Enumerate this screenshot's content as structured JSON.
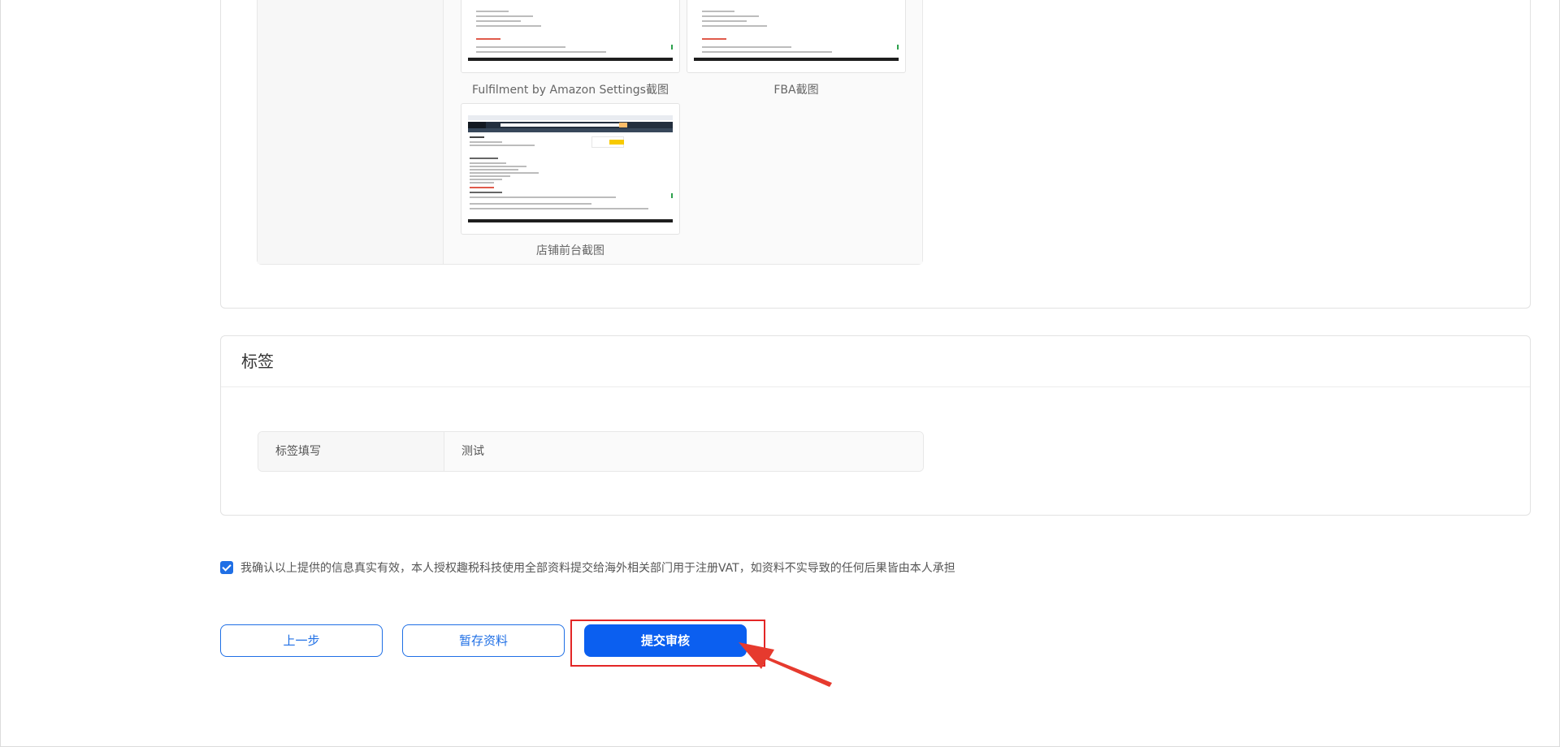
{
  "screenshots": {
    "items": [
      {
        "caption": "Fulfilment by Amazon Settings截图"
      },
      {
        "caption": "FBA截图"
      },
      {
        "caption": "店铺前台截图"
      }
    ]
  },
  "tags_section": {
    "title": "标签",
    "row_label": "标签填写",
    "row_value": "测试"
  },
  "agreement": {
    "checked": true,
    "text": "我确认以上提供的信息真实有效，本人授权趣税科技使用全部资料提交给海外相关部门用于注册VAT，如资料不实导致的任何后果皆由本人承担"
  },
  "buttons": {
    "prev_label": "上一步",
    "save_label": "暂存资料",
    "submit_label": "提交审核"
  },
  "colors": {
    "primary": "#0b5ff0",
    "annotation": "#e32626"
  }
}
